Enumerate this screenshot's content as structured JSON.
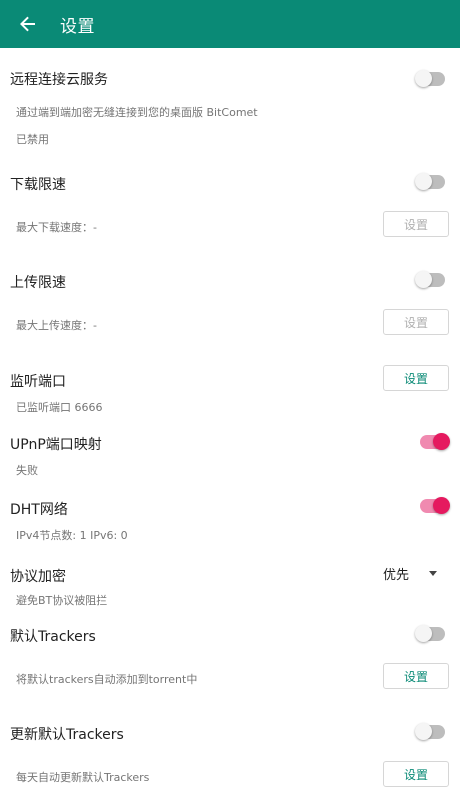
{
  "appbar": {
    "title": "设置"
  },
  "remote": {
    "title": "远程连接云服务",
    "desc": "通过端到端加密无缝连接到您的桌面版 BitComet",
    "status": "已禁用",
    "enabled": false
  },
  "download": {
    "title": "下载限速",
    "detail": "最大下载速度：-",
    "button": "设置",
    "enabled": false
  },
  "upload": {
    "title": "上传限速",
    "detail": "最大上传速度：-",
    "button": "设置",
    "enabled": false
  },
  "listen": {
    "title": "监听端口",
    "detail": "已监听端口 6666",
    "button": "设置"
  },
  "upnp": {
    "title": "UPnP端口映射",
    "status": "失败",
    "enabled": true
  },
  "dht": {
    "title": "DHT网络",
    "detail": "IPv4节点数: 1 IPv6: 0",
    "enabled": true
  },
  "encryption": {
    "title": "协议加密",
    "desc": "避免BT协议被阻拦",
    "selected": "优先"
  },
  "trackers": {
    "title": "默认Trackers",
    "desc": "将默认trackers自动添加到torrent中",
    "button": "设置",
    "enabled": false
  },
  "update_trackers": {
    "title": "更新默认Trackers",
    "desc": "每天自动更新默认Trackers",
    "button": "设置",
    "enabled": false
  },
  "colors": {
    "appbar": "#0a8a76",
    "accent_on": "#e5195f",
    "button_text": "#0a8a76"
  }
}
